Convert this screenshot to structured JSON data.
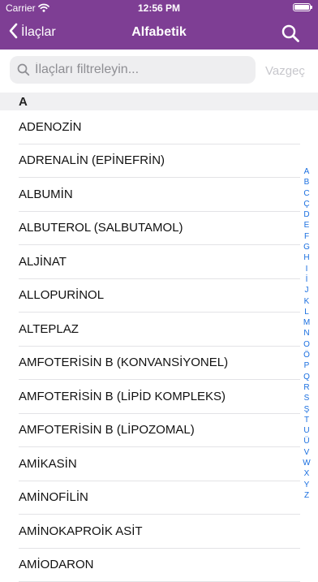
{
  "status_bar": {
    "carrier": "Carrier",
    "time": "12:56 PM"
  },
  "nav": {
    "back_label": "İlaçlar",
    "title": "Alfabetik"
  },
  "search": {
    "placeholder": "İlaçları filtreleyin...",
    "value": "",
    "cancel_label": "Vazgeç"
  },
  "section": {
    "letter": "A"
  },
  "items": [
    "ADENOZİN",
    "ADRENALİN (EPİNEFRİN)",
    "ALBUMİN",
    "ALBUTEROL (SALBUTAMOL)",
    "ALJİNAT",
    "ALLOPURİNOL",
    "ALTEPLAZ",
    "AMFOTERİSİN B (KONVANSİYONEL)",
    "AMFOTERİSİN B (LİPİD KOMPLEKS)",
    "AMFOTERİSİN B (LİPOZOMAL)",
    "AMİKASİN",
    "AMİNOFİLİN",
    "AMİNOKAPROİK ASİT",
    "AMİODARON"
  ],
  "index_letters": [
    "A",
    "B",
    "C",
    "Ç",
    "D",
    "E",
    "F",
    "G",
    "H",
    "I",
    "İ",
    "J",
    "K",
    "L",
    "M",
    "N",
    "O",
    "Ö",
    "P",
    "Q",
    "R",
    "S",
    "Ş",
    "T",
    "U",
    "Ü",
    "V",
    "W",
    "X",
    "Y",
    "Z"
  ],
  "colors": {
    "accent": "#7e3e94",
    "index_blue": "#1a6fe0"
  }
}
